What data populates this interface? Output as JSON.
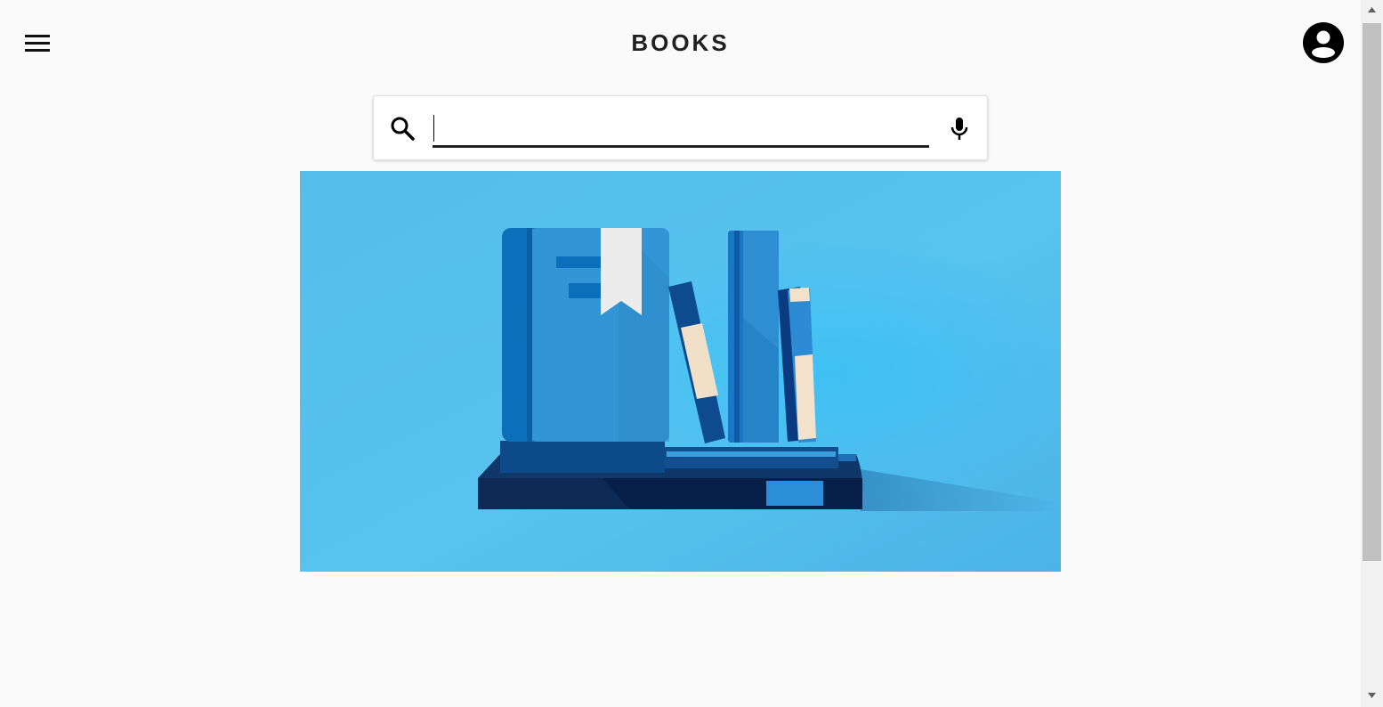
{
  "header": {
    "title": "BOOKS",
    "menu_icon": "menu-icon",
    "account_icon": "account-circle-icon"
  },
  "search": {
    "value": "",
    "placeholder": "",
    "search_icon": "search-icon",
    "mic_icon": "mic-icon"
  },
  "banner": {
    "image": "books-illustration",
    "alt": ""
  },
  "colors": {
    "background": "#fafafa",
    "banner_sky": "#56c0ec",
    "book_blue": "#2e96d8",
    "book_dark": "#0b3d72",
    "text": "#212121"
  }
}
